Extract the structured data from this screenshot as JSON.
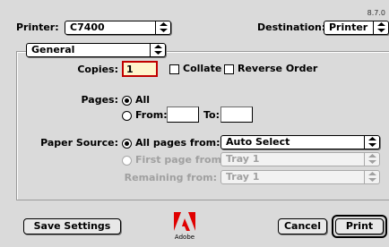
{
  "header": {
    "version": "8.7.0",
    "printer_label": "Printer:",
    "printer_value": "C7400",
    "destination_label": "Destination:",
    "destination_value": "Printer"
  },
  "panel": {
    "selected": "General"
  },
  "copies": {
    "label": "Copies:",
    "value": "1",
    "collate_label": "Collate",
    "reverse_label": "Reverse Order"
  },
  "pages": {
    "label": "Pages:",
    "all_label": "All",
    "from_label": "From:",
    "to_label": "To:",
    "from_value": "",
    "to_value": ""
  },
  "paper": {
    "label": "Paper Source:",
    "all_pages_label": "All pages from:",
    "all_pages_value": "Auto Select",
    "first_page_label": "First page from:",
    "first_page_value": "Tray 1",
    "remaining_label": "Remaining from:",
    "remaining_value": "Tray 1"
  },
  "footer": {
    "save_label": "Save Settings",
    "logo_text": "Adobe",
    "cancel_label": "Cancel",
    "print_label": "Print"
  },
  "icons": {
    "popup_arrow": "up-down-arrows-icon",
    "logo": "adobe-logo"
  }
}
